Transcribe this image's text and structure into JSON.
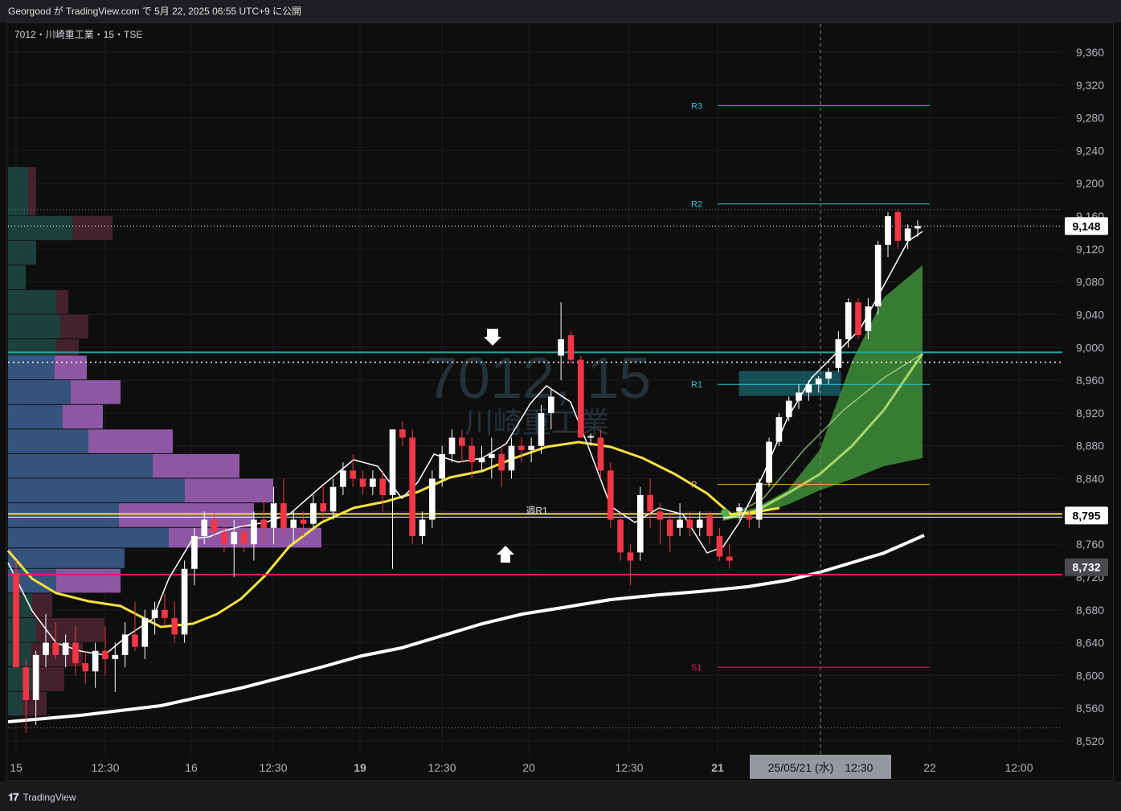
{
  "header": {
    "published_text": "Georgood が TradingView.com で 5月 22, 2025 06:55 UTC+9 に公開",
    "symbol_line": "7012・川崎重工業・15・TSE"
  },
  "watermark": {
    "main": "7012, 15",
    "sub": "川崎重工業"
  },
  "footer": {
    "brand": "TradingView"
  },
  "colors": {
    "up": "#ffffff",
    "down": "#f23645",
    "ema_fast": "#ffffff",
    "ema_mid": "#f5e13b",
    "ema_slow": "#ffffff",
    "cloud": "#4caf50",
    "pivot": "#26c6da",
    "support": "#e91e63"
  },
  "chart_data": {
    "type": "candlestick",
    "interval": "15",
    "ylim": [
      8520,
      9380
    ],
    "y_ticks": [
      "8,520",
      "8,560",
      "8,600",
      "8,640",
      "8,680",
      "8,720",
      "8,760",
      "8,800",
      "8,840",
      "8,880",
      "8,920",
      "8,960",
      "9,000",
      "9,040",
      "9,080",
      "9,120",
      "9,160",
      "9,200",
      "9,240",
      "9,280",
      "9,320",
      "9,360"
    ],
    "x_ticks": [
      "15",
      "12:30",
      "16",
      "12:30",
      "19",
      "12:30",
      "20",
      "12:30",
      "21",
      "12:30",
      "22",
      "12:00"
    ],
    "crosshair_time_label": "25/05/21 (水)　12:30",
    "price_badges": [
      {
        "label": "9,148",
        "value": 9148,
        "style": "white"
      },
      {
        "label": "8,795",
        "value": 8795,
        "style": "white"
      },
      {
        "label": "8,732",
        "value": 8732,
        "style": "gray"
      }
    ],
    "levels": [
      {
        "label": "R3",
        "value": 9295,
        "color": "#26c6da"
      },
      {
        "label": "R2",
        "value": 9175,
        "color": "#26c6da"
      },
      {
        "label": "R1",
        "value": 8955,
        "color": "#26c6da"
      },
      {
        "label": "P",
        "value": 8833,
        "color": "#f5b731"
      },
      {
        "label": "S1",
        "value": 8610,
        "color": "#e91e63"
      },
      {
        "label": "週R1",
        "value": 8795,
        "color": "#f5b731"
      }
    ],
    "horizontal_lines": [
      {
        "value": 8994,
        "color": "#26a69a"
      },
      {
        "value": 8723,
        "color": "#e91e63"
      }
    ],
    "candles": [
      {
        "o": 8725,
        "h": 8740,
        "l": 8610,
        "c": 8610
      },
      {
        "o": 8610,
        "h": 8620,
        "l": 8530,
        "c": 8570
      },
      {
        "o": 8570,
        "h": 8630,
        "l": 8540,
        "c": 8625
      },
      {
        "o": 8625,
        "h": 8675,
        "l": 8610,
        "c": 8640
      },
      {
        "o": 8640,
        "h": 8665,
        "l": 8620,
        "c": 8625
      },
      {
        "o": 8625,
        "h": 8650,
        "l": 8610,
        "c": 8640
      },
      {
        "o": 8640,
        "h": 8660,
        "l": 8600,
        "c": 8615
      },
      {
        "o": 8615,
        "h": 8630,
        "l": 8590,
        "c": 8605
      },
      {
        "o": 8605,
        "h": 8640,
        "l": 8585,
        "c": 8630
      },
      {
        "o": 8630,
        "h": 8660,
        "l": 8600,
        "c": 8620
      },
      {
        "o": 8620,
        "h": 8640,
        "l": 8580,
        "c": 8625
      },
      {
        "o": 8625,
        "h": 8665,
        "l": 8610,
        "c": 8650
      },
      {
        "o": 8650,
        "h": 8690,
        "l": 8630,
        "c": 8635
      },
      {
        "o": 8635,
        "h": 8680,
        "l": 8620,
        "c": 8670
      },
      {
        "o": 8670,
        "h": 8690,
        "l": 8650,
        "c": 8680
      },
      {
        "o": 8680,
        "h": 8700,
        "l": 8660,
        "c": 8670
      },
      {
        "o": 8670,
        "h": 8690,
        "l": 8640,
        "c": 8650
      },
      {
        "o": 8650,
        "h": 8740,
        "l": 8640,
        "c": 8730
      },
      {
        "o": 8730,
        "h": 8780,
        "l": 8710,
        "c": 8770
      },
      {
        "o": 8770,
        "h": 8800,
        "l": 8760,
        "c": 8790
      },
      {
        "o": 8790,
        "h": 8800,
        "l": 8770,
        "c": 8775
      },
      {
        "o": 8775,
        "h": 8790,
        "l": 8750,
        "c": 8760
      },
      {
        "o": 8760,
        "h": 8790,
        "l": 8720,
        "c": 8775
      },
      {
        "o": 8775,
        "h": 8790,
        "l": 8750,
        "c": 8760
      },
      {
        "o": 8760,
        "h": 8800,
        "l": 8740,
        "c": 8790
      },
      {
        "o": 8790,
        "h": 8820,
        "l": 8760,
        "c": 8780
      },
      {
        "o": 8780,
        "h": 8830,
        "l": 8760,
        "c": 8810
      },
      {
        "o": 8810,
        "h": 8840,
        "l": 8770,
        "c": 8780
      },
      {
        "o": 8780,
        "h": 8800,
        "l": 8760,
        "c": 8790
      },
      {
        "o": 8790,
        "h": 8800,
        "l": 8770,
        "c": 8785
      },
      {
        "o": 8785,
        "h": 8820,
        "l": 8780,
        "c": 8810
      },
      {
        "o": 8810,
        "h": 8830,
        "l": 8790,
        "c": 8800
      },
      {
        "o": 8800,
        "h": 8840,
        "l": 8790,
        "c": 8830
      },
      {
        "o": 8830,
        "h": 8860,
        "l": 8820,
        "c": 8850
      },
      {
        "o": 8850,
        "h": 8870,
        "l": 8830,
        "c": 8840
      },
      {
        "o": 8840,
        "h": 8850,
        "l": 8820,
        "c": 8830
      },
      {
        "o": 8830,
        "h": 8850,
        "l": 8820,
        "c": 8840
      },
      {
        "o": 8840,
        "h": 8850,
        "l": 8800,
        "c": 8820
      },
      {
        "o": 8820,
        "h": 8900,
        "l": 8730,
        "c": 8900
      },
      {
        "o": 8900,
        "h": 8910,
        "l": 8880,
        "c": 8890
      },
      {
        "o": 8890,
        "h": 8900,
        "l": 8760,
        "c": 8770
      },
      {
        "o": 8770,
        "h": 8800,
        "l": 8760,
        "c": 8790
      },
      {
        "o": 8790,
        "h": 8850,
        "l": 8780,
        "c": 8840
      },
      {
        "o": 8840,
        "h": 8880,
        "l": 8830,
        "c": 8870
      },
      {
        "o": 8870,
        "h": 8900,
        "l": 8860,
        "c": 8890
      },
      {
        "o": 8890,
        "h": 8900,
        "l": 8860,
        "c": 8880
      },
      {
        "o": 8880,
        "h": 8890,
        "l": 8840,
        "c": 8860
      },
      {
        "o": 8860,
        "h": 8880,
        "l": 8850,
        "c": 8865
      },
      {
        "o": 8865,
        "h": 8890,
        "l": 8840,
        "c": 8870
      },
      {
        "o": 8870,
        "h": 8880,
        "l": 8830,
        "c": 8850
      },
      {
        "o": 8850,
        "h": 8890,
        "l": 8840,
        "c": 8880
      },
      {
        "o": 8880,
        "h": 8890,
        "l": 8860,
        "c": 8875
      },
      {
        "o": 8875,
        "h": 8890,
        "l": 8860,
        "c": 8880
      },
      {
        "o": 8880,
        "h": 8930,
        "l": 8870,
        "c": 8920
      },
      {
        "o": 8920,
        "h": 8950,
        "l": 8900,
        "c": 8940
      },
      {
        "o": 8990,
        "h": 9055,
        "l": 8960,
        "c": 9010
      },
      {
        "o": 9015,
        "h": 9020,
        "l": 8980,
        "c": 8985
      },
      {
        "o": 8985,
        "h": 8990,
        "l": 8890,
        "c": 8890
      },
      {
        "o": 8890,
        "h": 8895,
        "l": 8880,
        "c": 8892
      },
      {
        "o": 8890,
        "h": 8900,
        "l": 8840,
        "c": 8850
      },
      {
        "o": 8850,
        "h": 8860,
        "l": 8780,
        "c": 8790
      },
      {
        "o": 8790,
        "h": 8800,
        "l": 8740,
        "c": 8750
      },
      {
        "o": 8750,
        "h": 8760,
        "l": 8710,
        "c": 8740
      },
      {
        "o": 8750,
        "h": 8830,
        "l": 8740,
        "c": 8820
      },
      {
        "o": 8820,
        "h": 8840,
        "l": 8780,
        "c": 8800
      },
      {
        "o": 8800,
        "h": 8810,
        "l": 8760,
        "c": 8790
      },
      {
        "o": 8790,
        "h": 8800,
        "l": 8750,
        "c": 8770
      },
      {
        "o": 8780,
        "h": 8810,
        "l": 8770,
        "c": 8790
      },
      {
        "o": 8790,
        "h": 8800,
        "l": 8770,
        "c": 8780
      },
      {
        "o": 8780,
        "h": 8800,
        "l": 8770,
        "c": 8790
      },
      {
        "o": 8795,
        "h": 8800,
        "l": 8760,
        "c": 8770
      },
      {
        "o": 8770,
        "h": 8780,
        "l": 8740,
        "c": 8745
      },
      {
        "o": 8745,
        "h": 8760,
        "l": 8730,
        "c": 8740
      },
      {
        "o": 8800,
        "h": 8810,
        "l": 8790,
        "c": 8805
      },
      {
        "o": 8795,
        "h": 8800,
        "l": 8780,
        "c": 8790
      },
      {
        "o": 8790,
        "h": 8840,
        "l": 8780,
        "c": 8835
      },
      {
        "o": 8835,
        "h": 8890,
        "l": 8830,
        "c": 8885
      },
      {
        "o": 8885,
        "h": 8920,
        "l": 8880,
        "c": 8915
      },
      {
        "o": 8915,
        "h": 8940,
        "l": 8910,
        "c": 8935
      },
      {
        "o": 8935,
        "h": 8955,
        "l": 8925,
        "c": 8945
      },
      {
        "o": 8945,
        "h": 8960,
        "l": 8935,
        "c": 8955
      },
      {
        "o": 8955,
        "h": 8965,
        "l": 8945,
        "c": 8962
      },
      {
        "o": 8962,
        "h": 8975,
        "l": 8955,
        "c": 8970
      },
      {
        "o": 8975,
        "h": 9020,
        "l": 8970,
        "c": 9010
      },
      {
        "o": 9010,
        "h": 9060,
        "l": 9000,
        "c": 9055
      },
      {
        "o": 9055,
        "h": 9060,
        "l": 9010,
        "c": 9015
      },
      {
        "o": 9020,
        "h": 9060,
        "l": 9010,
        "c": 9050
      },
      {
        "o": 9050,
        "h": 9130,
        "l": 9040,
        "c": 9125
      },
      {
        "o": 9125,
        "h": 9165,
        "l": 9110,
        "c": 9160
      },
      {
        "o": 9165,
        "h": 9168,
        "l": 9120,
        "c": 9130
      },
      {
        "o": 9130,
        "h": 9150,
        "l": 9120,
        "c": 9145
      },
      {
        "o": 9145,
        "h": 9155,
        "l": 9135,
        "c": 9148
      }
    ]
  }
}
